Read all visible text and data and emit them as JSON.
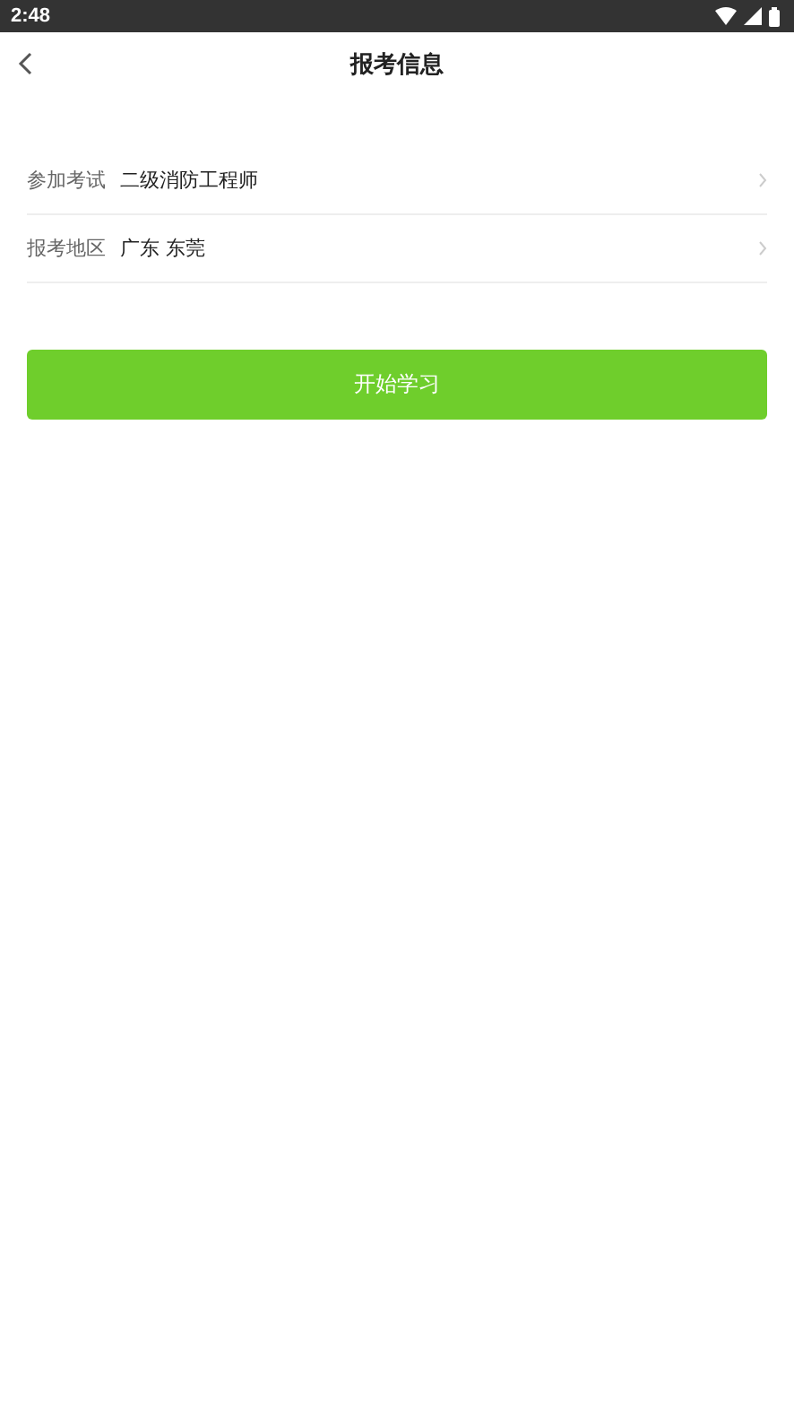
{
  "status_bar": {
    "time": "2:48"
  },
  "header": {
    "title": "报考信息"
  },
  "rows": [
    {
      "label": "参加考试",
      "value": "二级消防工程师"
    },
    {
      "label": "报考地区",
      "value": "广东 东莞"
    }
  ],
  "start_button": {
    "label": "开始学习"
  }
}
